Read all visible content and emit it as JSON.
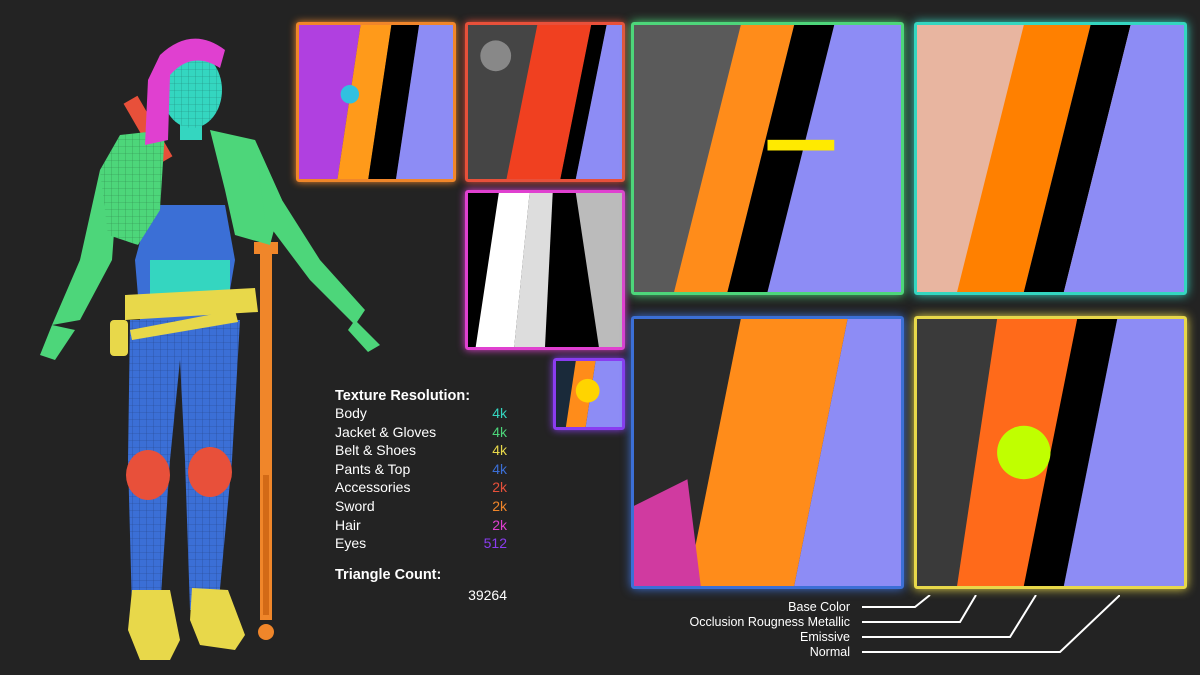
{
  "colors": {
    "background": "#232323",
    "body": "#34d6c0",
    "jacket_gloves": "#4dd67a",
    "belt_shoes": "#e8d84a",
    "pants_top": "#3b6fd6",
    "accessories": "#e8503a",
    "sword": "#f0862a",
    "hair": "#e040d0",
    "eyes": "#8a3cf0",
    "base_color_strip": "#ff8c1a",
    "occlusion_strip": "#ff8c1a",
    "emissive_strip": "#000000",
    "normal_strip": "#8d8cf5"
  },
  "texture_resolution": {
    "heading": "Texture Resolution:",
    "items": [
      {
        "label": "Body",
        "value": "4k"
      },
      {
        "label": "Jacket & Gloves",
        "value": "4k"
      },
      {
        "label": "Belt & Shoes",
        "value": "4k"
      },
      {
        "label": "Pants & Top",
        "value": "4k"
      },
      {
        "label": "Accessories",
        "value": "2k"
      },
      {
        "label": "Sword",
        "value": "2k"
      },
      {
        "label": "Hair",
        "value": "2k"
      },
      {
        "label": "Eyes",
        "value": "512"
      }
    ]
  },
  "triangle_count": {
    "heading": "Triangle Count:",
    "value": "39264"
  },
  "legend": [
    "Base Color",
    "Occlusion Rougness Metallic",
    "Emissive",
    "Normal"
  ]
}
